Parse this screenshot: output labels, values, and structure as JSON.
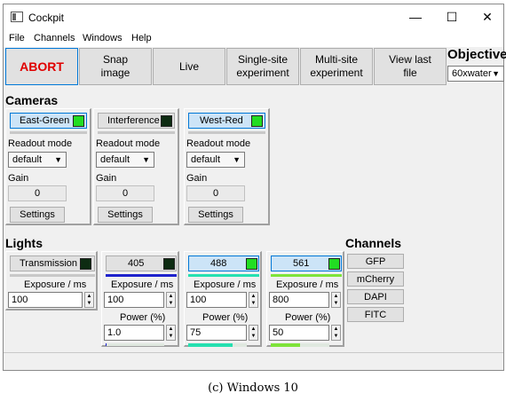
{
  "window": {
    "title": "Cockpit",
    "minimize": "—",
    "maximize": "☐",
    "close": "✕"
  },
  "menu": [
    "File",
    "Channels",
    "Windows",
    "Help"
  ],
  "toolbar": {
    "abort": "ABORT",
    "snap": "Snap\nimage",
    "live": "Live",
    "single": "Single-site\nexperiment",
    "multi": "Multi-site\nexperiment",
    "viewlast": "View last\nfile"
  },
  "objective": {
    "label": "Objective",
    "value": "60xwater"
  },
  "cameras": {
    "title": "Cameras",
    "items": [
      {
        "name": "East-Green",
        "swatch": "#22dd22",
        "selected": true,
        "readout_label": "Readout mode",
        "readout": "default",
        "gain_label": "Gain",
        "gain": "0",
        "settings": "Settings"
      },
      {
        "name": "Interference",
        "swatch": "#0d2b12",
        "selected": false,
        "readout_label": "Readout mode",
        "readout": "default",
        "gain_label": "Gain",
        "gain": "0",
        "settings": "Settings"
      },
      {
        "name": "West-Red",
        "swatch": "#22dd22",
        "selected": true,
        "readout_label": "Readout mode",
        "readout": "default",
        "gain_label": "Gain",
        "gain": "0",
        "settings": "Settings"
      }
    ]
  },
  "lights": {
    "title": "Lights",
    "items": [
      {
        "name": "Transmission",
        "swatch": "#0d2b12",
        "selected": false,
        "bar_color": "",
        "exposure_label": "Exposure / ms",
        "exposure": "100",
        "power_label": "",
        "power": ""
      },
      {
        "name": "405",
        "swatch": "#0d2b12",
        "selected": false,
        "bar_color": "#1e22cc",
        "exposure_label": "Exposure / ms",
        "exposure": "100",
        "power_label": "Power (%)",
        "power": "1.0",
        "power_level": 0.01
      },
      {
        "name": "488",
        "swatch": "#22dd22",
        "selected": true,
        "bar_color": "#26e0b0",
        "exposure_label": "Exposure / ms",
        "exposure": "100",
        "power_label": "Power (%)",
        "power": "75",
        "power_level": 0.75
      },
      {
        "name": "561",
        "swatch": "#22dd22",
        "selected": true,
        "bar_color": "#7ee33a",
        "exposure_label": "Exposure / ms",
        "exposure": "800",
        "power_label": "Power (%)",
        "power": "50",
        "power_level": 0.5
      }
    ]
  },
  "channels": {
    "title": "Channels",
    "items": [
      "GFP",
      "mCherry",
      "DAPI",
      "FITC"
    ]
  },
  "caption": "(c) Windows 10"
}
